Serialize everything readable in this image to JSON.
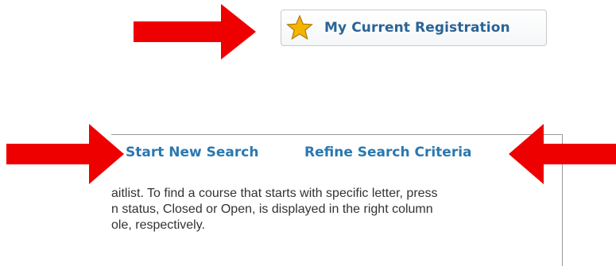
{
  "registration_button": {
    "label": "My Current Registration",
    "icon": "star-icon"
  },
  "search_links": {
    "start_new": "Start New Search",
    "refine": "Refine Search Criteria"
  },
  "description_lines": [
    "aitlist. To find a course that starts with specific letter, press",
    "n status, Closed or Open, is displayed in the right column",
    "ole, respectively."
  ],
  "annotation_arrows": [
    {
      "points_to": "my-current-registration-button",
      "direction": "right",
      "color": "#ee0000"
    },
    {
      "points_to": "start-new-search-link",
      "direction": "right",
      "color": "#ee0000"
    },
    {
      "points_to": "refine-search-criteria-link",
      "direction": "left",
      "color": "#ee0000"
    }
  ],
  "colors": {
    "link": "#2a78b0",
    "arrow": "#ee0000",
    "text": "#333333",
    "star": "#f5b400"
  }
}
